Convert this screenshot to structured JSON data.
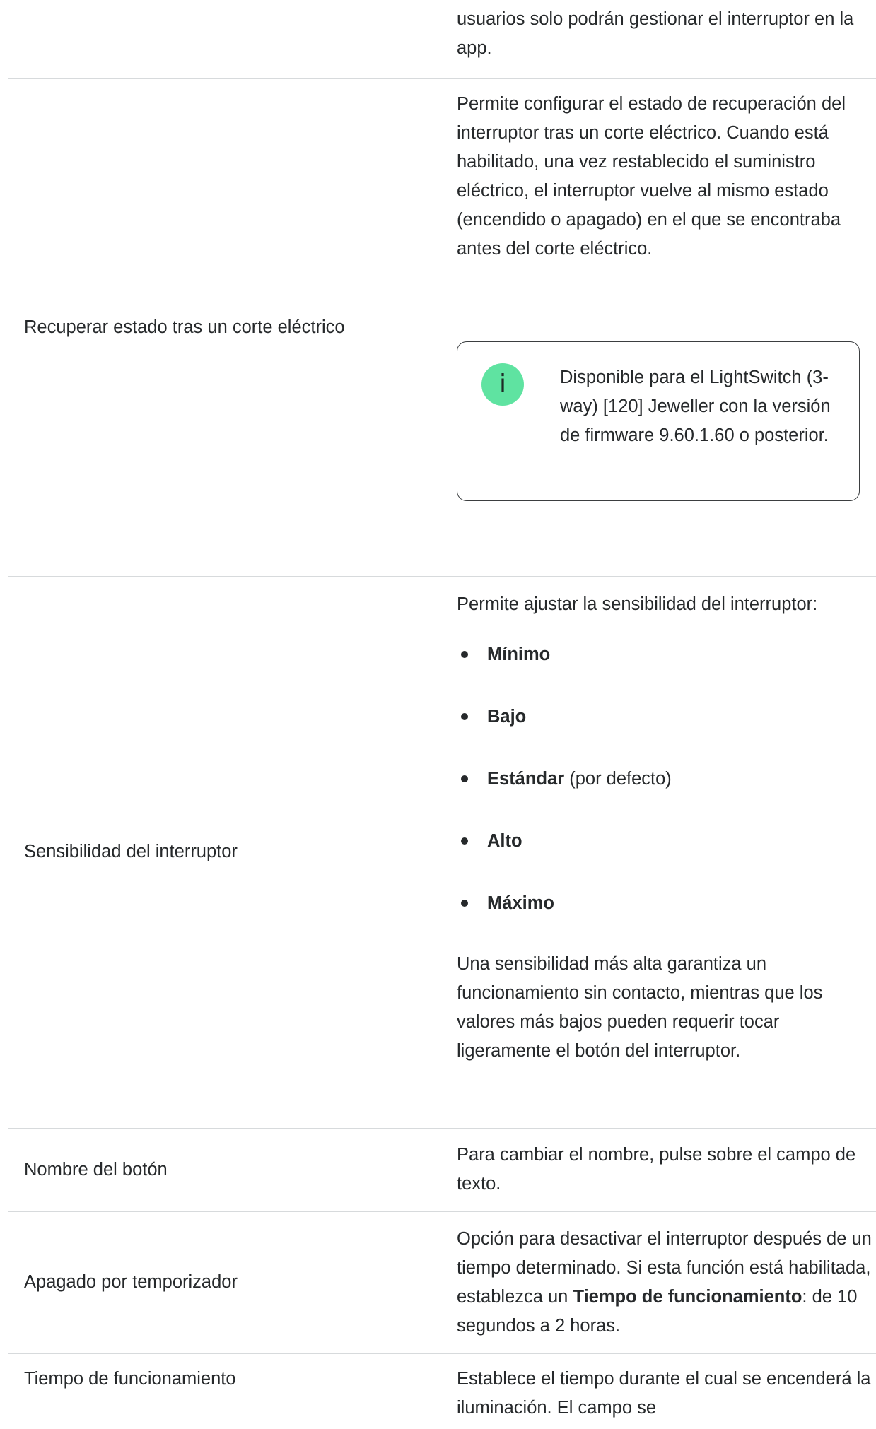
{
  "rows": [
    {
      "name": "",
      "desc": "usuarios solo podrán gestionar el interruptor en la app."
    },
    {
      "name": "Recuperar estado tras un corte eléctrico",
      "desc": "Permite configurar el estado de recuperación del interruptor tras un corte eléctrico. Cuando está habilitado, una vez restablecido el suministro eléctrico, el interruptor vuelve al mismo estado (encendido o apagado) en el que se encontraba antes del corte eléctrico.",
      "note": {
        "icon": "info-icon",
        "icon_glyph": "i",
        "icon_color": "#5fe3a1",
        "text": "Disponible para el LightSwitch (3-way) [120] Jeweller con la versión de firmware 9.60.1.60 o posterior."
      }
    },
    {
      "name": "Sensibilidad del interruptor",
      "intro": "Permite ajustar la sensibilidad del interruptor:",
      "levels": [
        {
          "label": "Mínimo",
          "suffix": ""
        },
        {
          "label": "Bajo",
          "suffix": ""
        },
        {
          "label": "Estándar",
          "suffix": " (por defecto)"
        },
        {
          "label": "Alto",
          "suffix": ""
        },
        {
          "label": "Máximo",
          "suffix": ""
        }
      ],
      "outro": "Una sensibilidad más alta garantiza un funcionamiento sin contacto, mientras que los valores más bajos pueden requerir tocar ligeramente el botón del interruptor."
    },
    {
      "name": "Nombre del botón",
      "desc": "Para cambiar el nombre, pulse sobre el campo de texto."
    },
    {
      "name": "Apagado por temporizador",
      "desc_before": "Opción para desactivar el interruptor después de un tiempo determinado. Si esta función está habilitada, establezca un ",
      "desc_bold": "Tiempo de funcionamiento",
      "desc_after": ": de 10 segundos a 2 horas."
    },
    {
      "name": "Tiempo de funcionamiento",
      "desc": "Establece el tiempo durante el cual se encenderá la iluminación. El campo se"
    }
  ],
  "colors": {
    "text": "#26292b",
    "border": "#d7dadc",
    "note_border": "#3b3e40"
  }
}
